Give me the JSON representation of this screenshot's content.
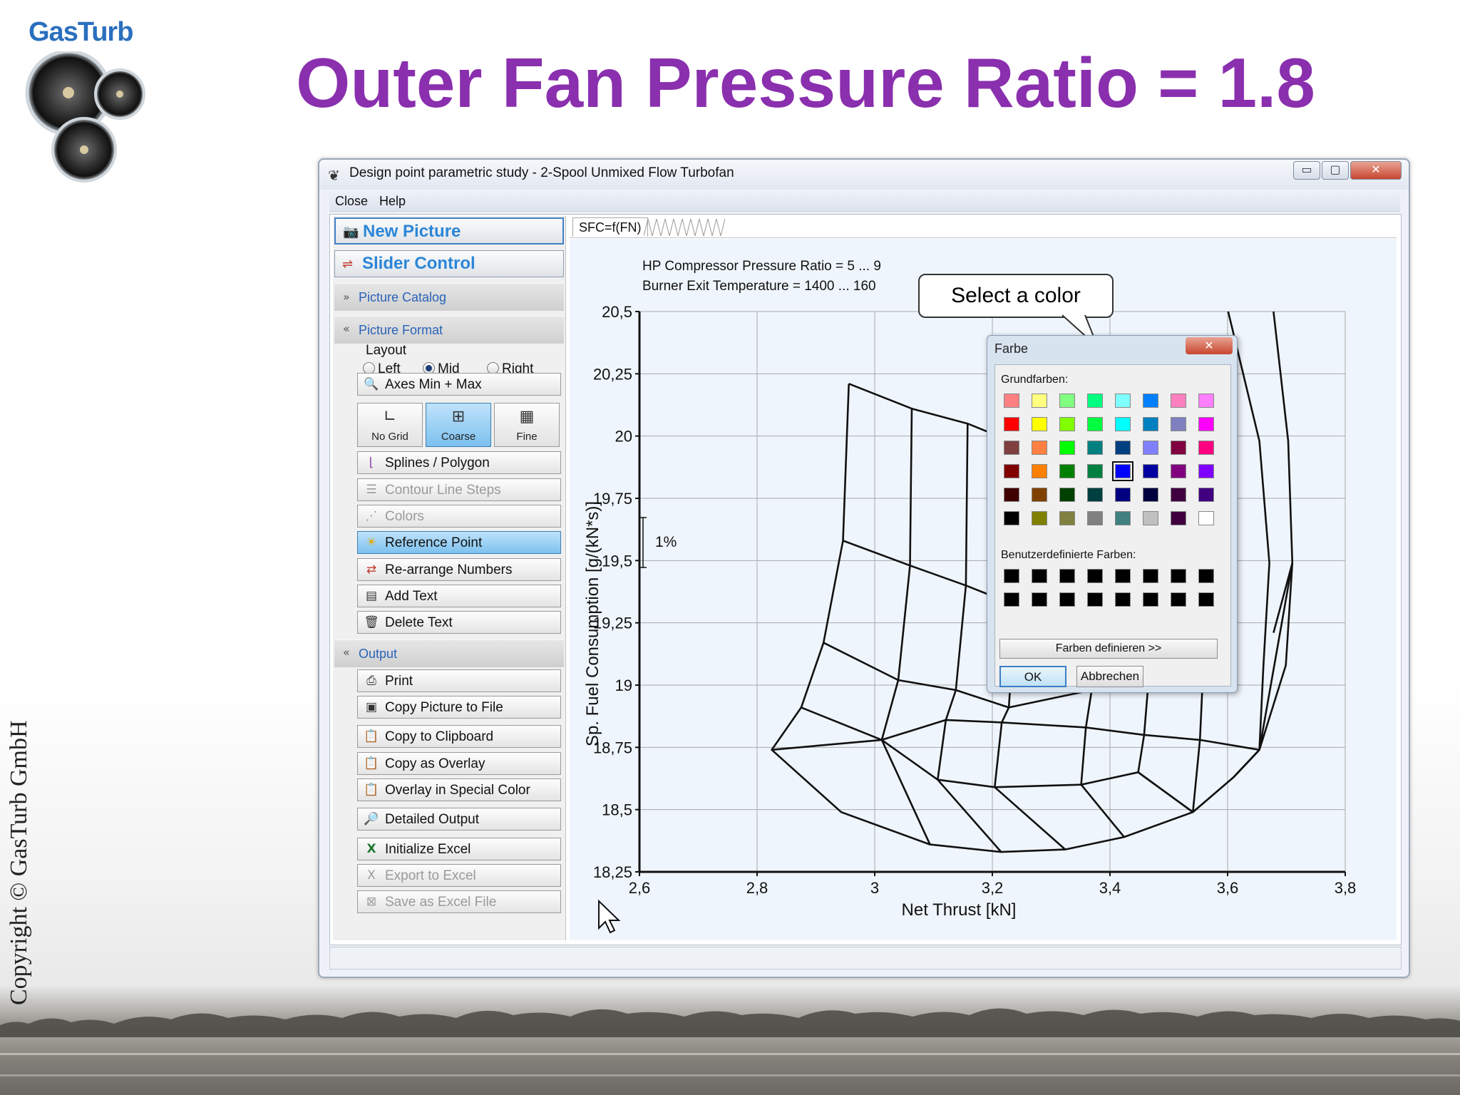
{
  "slide": {
    "title": "Outer Fan Pressure Ratio = 1.8",
    "logo_text": "GasTurb",
    "copyright": "Copyright © GasTurb GmbH"
  },
  "window": {
    "title": "Design point parametric study - 2-Spool Unmixed Flow Turbofan",
    "icon": "app-icon",
    "controls": {
      "minimize": "▭",
      "maximize": "▢",
      "close": "✕"
    }
  },
  "menu": {
    "items": [
      "Close",
      "Help"
    ]
  },
  "left_panel": {
    "new_picture": "New Picture",
    "slider_control": "Slider Control",
    "sections": {
      "picture_catalog": "Picture Catalog",
      "picture_format": "Picture Format",
      "output": "Output"
    },
    "layout": {
      "label": "Layout",
      "options": [
        "Left",
        "Mid",
        "Right"
      ],
      "selected": "Mid"
    },
    "axes_min_max": "Axes Min + Max",
    "grid_buttons": [
      "No Grid",
      "Coarse",
      "Fine"
    ],
    "grid_selected": "Coarse",
    "format_buttons": [
      {
        "label": "Splines / Polygon",
        "enabled": true
      },
      {
        "label": "Contour Line Steps",
        "enabled": false
      },
      {
        "label": "Colors",
        "enabled": false
      },
      {
        "label": "Reference Point",
        "enabled": true,
        "selected": true
      },
      {
        "label": "Re-arrange Numbers",
        "enabled": true
      },
      {
        "label": "Add Text",
        "enabled": true
      },
      {
        "label": "Delete Text",
        "enabled": true
      }
    ],
    "output_buttons": [
      {
        "label": "Print",
        "enabled": true
      },
      {
        "label": "Copy Picture to File",
        "enabled": true
      },
      {
        "label": "Copy to Clipboard",
        "enabled": true
      },
      {
        "label": "Copy as Overlay",
        "enabled": true
      },
      {
        "label": "Overlay in Special Color",
        "enabled": true
      },
      {
        "label": "Detailed Output",
        "enabled": true
      },
      {
        "label": "Initialize Excel",
        "enabled": true
      },
      {
        "label": "Export to Excel",
        "enabled": false
      },
      {
        "label": "Save as Excel File",
        "enabled": false
      }
    ]
  },
  "tab": {
    "label": "SFC=f(FN)"
  },
  "chart_data": {
    "type": "line",
    "annotations": [
      "HP Compressor Pressure Ratio = 5 ... 9",
      "Burner Exit Temperature = 1400 ... 160"
    ],
    "scale_marker": "1%",
    "xlabel": "Net Thrust [kN]",
    "ylabel": "Sp. Fuel Consumption [g/(kN*s)]",
    "xlim": [
      2.6,
      3.8
    ],
    "ylim": [
      18.25,
      20.5
    ],
    "x_ticks": [
      "2,6",
      "2,8",
      "3",
      "3,2",
      "3,4",
      "3,6",
      "3,8"
    ],
    "y_ticks": [
      "18,25",
      "18,5",
      "18,75",
      "19",
      "19,25",
      "19,5",
      "19,75",
      "20",
      "20,25",
      "20,5"
    ],
    "grid": "coarse",
    "carpet_lines": [
      {
        "points": [
          [
            2.956,
            20.21
          ],
          [
            2.946,
            19.58
          ],
          [
            2.913,
            19.17
          ],
          [
            2.875,
            18.91
          ],
          [
            2.825,
            18.74
          ],
          [
            2.943,
            18.49
          ],
          [
            3.094,
            18.36
          ],
          [
            3.215,
            18.33
          ],
          [
            3.324,
            18.34
          ],
          [
            3.424,
            18.39
          ],
          [
            3.541,
            18.49
          ],
          [
            3.61,
            18.63
          ],
          [
            3.654,
            18.74
          ]
        ]
      },
      {
        "points": [
          [
            3.063,
            20.11
          ],
          [
            3.06,
            19.48
          ],
          [
            3.04,
            19.02
          ],
          [
            3.012,
            18.78
          ],
          [
            3.094,
            18.36
          ]
        ]
      },
      {
        "points": [
          [
            3.158,
            20.05
          ],
          [
            3.155,
            19.4
          ],
          [
            3.138,
            18.98
          ],
          [
            3.121,
            18.86
          ],
          [
            3.107,
            18.62
          ],
          [
            3.215,
            18.33
          ]
        ]
      },
      {
        "points": [
          [
            3.241,
            19.97
          ],
          [
            3.24,
            19.32
          ],
          [
            3.228,
            18.91
          ],
          [
            3.216,
            18.85
          ],
          [
            3.204,
            18.59
          ],
          [
            3.324,
            18.34
          ]
        ]
      },
      {
        "points": [
          [
            3.369,
            18.98
          ],
          [
            3.359,
            18.83
          ],
          [
            3.351,
            18.6
          ],
          [
            3.424,
            18.39
          ]
        ]
      },
      {
        "points": [
          [
            3.465,
            19.0
          ],
          [
            3.458,
            18.8
          ],
          [
            3.448,
            18.65
          ],
          [
            3.541,
            18.49
          ]
        ]
      },
      {
        "points": [
          [
            3.558,
            19.04
          ],
          [
            3.553,
            18.78
          ],
          [
            3.541,
            18.49
          ]
        ]
      },
      {
        "points": [
          [
            3.601,
            20.5
          ],
          [
            3.654,
            19.98
          ],
          [
            3.671,
            19.49
          ],
          [
            3.661,
            19.08
          ],
          [
            3.654,
            18.74
          ]
        ]
      },
      {
        "points": [
          [
            3.678,
            20.5
          ],
          [
            3.703,
            19.98
          ],
          [
            3.71,
            19.49
          ],
          [
            3.699,
            19.08
          ],
          [
            3.654,
            18.74
          ]
        ]
      },
      {
        "points": [
          [
            2.946,
            19.58
          ],
          [
            3.06,
            19.48
          ],
          [
            3.155,
            19.4
          ],
          [
            3.24,
            19.32
          ]
        ]
      },
      {
        "points": [
          [
            2.913,
            19.17
          ],
          [
            3.04,
            19.02
          ],
          [
            3.138,
            18.98
          ],
          [
            3.228,
            18.91
          ],
          [
            3.369,
            18.98
          ],
          [
            3.465,
            19.0
          ],
          [
            3.558,
            19.04
          ]
        ]
      },
      {
        "points": [
          [
            2.875,
            18.91
          ],
          [
            3.012,
            18.78
          ],
          [
            3.121,
            18.86
          ],
          [
            3.216,
            18.85
          ],
          [
            3.359,
            18.83
          ],
          [
            3.458,
            18.8
          ],
          [
            3.553,
            18.78
          ],
          [
            3.654,
            18.74
          ]
        ]
      },
      {
        "points": [
          [
            2.825,
            18.74
          ],
          [
            3.012,
            18.78
          ],
          [
            3.107,
            18.62
          ],
          [
            3.204,
            18.59
          ],
          [
            3.351,
            18.6
          ],
          [
            3.448,
            18.65
          ],
          [
            3.541,
            18.49
          ]
        ]
      },
      {
        "points": [
          [
            2.956,
            20.21
          ],
          [
            3.063,
            20.11
          ],
          [
            3.158,
            20.05
          ],
          [
            3.241,
            19.97
          ]
        ]
      },
      {
        "points": [
          [
            3.541,
            18.49
          ],
          [
            3.61,
            18.63
          ],
          [
            3.654,
            18.74
          ],
          [
            3.71,
            19.49
          ]
        ]
      },
      {
        "points": [
          [
            3.678,
            19.21
          ],
          [
            3.71,
            19.49
          ]
        ]
      }
    ]
  },
  "callout": {
    "text": "Select a color"
  },
  "color_dialog": {
    "title": "Farbe",
    "basic_label": "Grundfarben:",
    "custom_label": "Benutzerdefinierte Farben:",
    "define_button": "Farben definieren >>",
    "ok": "OK",
    "cancel": "Abbrechen",
    "selected_index": 28,
    "basic_colors": [
      "#ff8080",
      "#ffff80",
      "#80ff80",
      "#00ff80",
      "#80ffff",
      "#0080ff",
      "#ff80c0",
      "#ff80ff",
      "#ff0000",
      "#ffff00",
      "#80ff00",
      "#00ff40",
      "#00ffff",
      "#0080c0",
      "#8080c0",
      "#ff00ff",
      "#804040",
      "#ff8040",
      "#00ff00",
      "#008080",
      "#004080",
      "#8080ff",
      "#800040",
      "#ff0080",
      "#800000",
      "#ff8000",
      "#008000",
      "#008040",
      "#0000ff",
      "#0000a0",
      "#800080",
      "#8000ff",
      "#400000",
      "#804000",
      "#004000",
      "#004040",
      "#000080",
      "#000040",
      "#400040",
      "#400080",
      "#000000",
      "#808000",
      "#808040",
      "#808080",
      "#408080",
      "#c0c0c0",
      "#400040",
      "#ffffff"
    ],
    "custom_colors": [
      "#000000",
      "#000000",
      "#000000",
      "#000000",
      "#000000",
      "#000000",
      "#000000",
      "#000000",
      "#000000",
      "#000000",
      "#000000",
      "#000000",
      "#000000",
      "#000000",
      "#000000",
      "#000000"
    ]
  }
}
